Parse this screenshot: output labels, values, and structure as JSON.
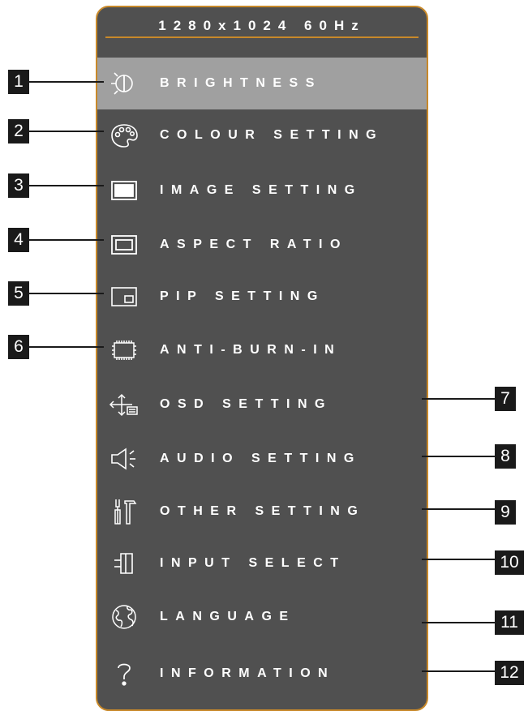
{
  "osd": {
    "resolution": "1280x1024 60Hz",
    "menu_items": [
      {
        "label": "BRIGHTNESS",
        "icon": "brightness-icon",
        "callout": "1",
        "selected": true
      },
      {
        "label": "COLOUR SETTING",
        "icon": "palette-icon",
        "callout": "2"
      },
      {
        "label": "IMAGE SETTING",
        "icon": "image-icon",
        "callout": "3"
      },
      {
        "label": "ASPECT RATIO",
        "icon": "aspect-ratio-icon",
        "callout": "4"
      },
      {
        "label": "PIP SETTING",
        "icon": "pip-icon",
        "callout": "5"
      },
      {
        "label": "ANTI-BURN-IN",
        "icon": "chip-icon",
        "callout": "6"
      },
      {
        "label": "OSD SETTING",
        "icon": "osd-move-icon",
        "callout": "7"
      },
      {
        "label": "AUDIO SETTING",
        "icon": "speaker-icon",
        "callout": "8"
      },
      {
        "label": "OTHER SETTING",
        "icon": "tools-icon",
        "callout": "9"
      },
      {
        "label": "INPUT SELECT",
        "icon": "input-plug-icon",
        "callout": "10"
      },
      {
        "label": "LANGUAGE",
        "icon": "globe-icon",
        "callout": "11"
      },
      {
        "label": "INFORMATION",
        "icon": "question-icon",
        "callout": "12"
      }
    ]
  },
  "colors": {
    "panel": "#505050",
    "border": "#c8892a",
    "selected": "#a0a0a0",
    "callout": "#1a1a1a"
  }
}
